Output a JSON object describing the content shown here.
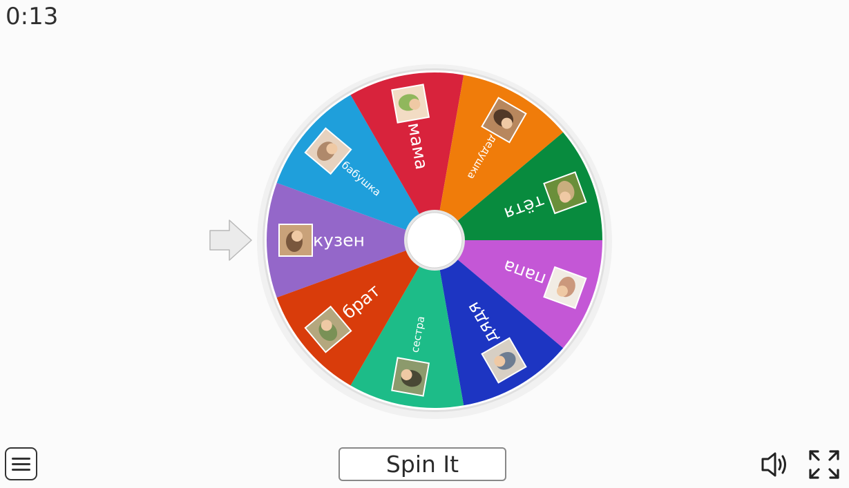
{
  "timer": "0:13",
  "spin_button": "Spin It",
  "colors": {
    "background": "#fbfbfb",
    "hub": "#ffffff",
    "pointer_fill": "#ebebeb",
    "pointer_stroke": "#b8b8b8"
  },
  "wheel": {
    "segments": [
      {
        "label": "кузен",
        "color": "#9467c9",
        "image_icon": "cousin-photo-icon"
      },
      {
        "label": "бабушка",
        "color": "#1f9fdb",
        "image_icon": "grandma-photo-icon"
      },
      {
        "label": "мама",
        "color": "#d8233c",
        "image_icon": "mom-photo-icon"
      },
      {
        "label": "дедушка",
        "color": "#f07c0a",
        "image_icon": "grandpa-photo-icon"
      },
      {
        "label": "тётя",
        "color": "#088b3e",
        "image_icon": "aunt-photo-icon"
      },
      {
        "label": "папа",
        "color": "#c457d6",
        "image_icon": "dad-photo-icon"
      },
      {
        "label": "дядя",
        "color": "#1d35c2",
        "image_icon": "uncle-photo-icon"
      },
      {
        "label": "сестра",
        "color": "#1dbc88",
        "image_icon": "sister-photo-icon"
      },
      {
        "label": "брат",
        "color": "#d93c0b",
        "image_icon": "brother-photo-icon"
      }
    ]
  },
  "icons": {
    "menu": "menu-icon",
    "sound": "speaker-icon",
    "fullscreen": "fullscreen-icon",
    "pointer": "arrow-pointer-icon"
  }
}
